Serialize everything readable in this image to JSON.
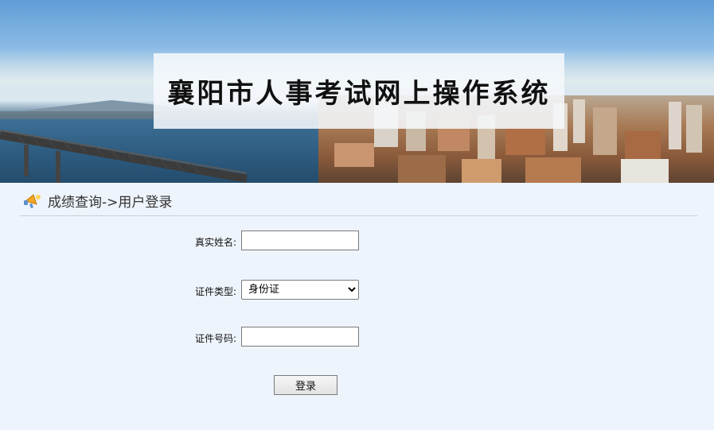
{
  "banner": {
    "title": "襄阳市人事考试网上操作系统"
  },
  "breadcrumb": {
    "text": "成绩查询->用户登录",
    "icon": "megaphone-icon"
  },
  "form": {
    "name_label": "真实姓名:",
    "name_value": "",
    "idtype_label": "证件类型:",
    "idtype_selected": "身份证",
    "idnum_label": "证件号码:",
    "idnum_value": "",
    "submit_label": "登录"
  },
  "colors": {
    "page_bg": "#eef4fc",
    "divider": "#c9cfd6"
  }
}
